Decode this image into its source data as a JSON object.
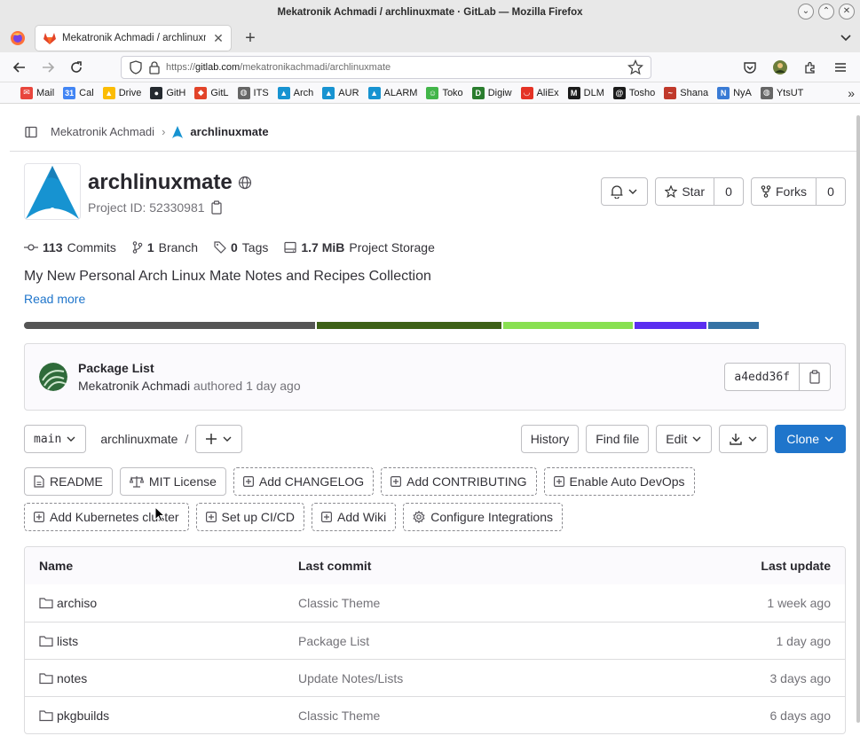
{
  "window": {
    "title": "Mekatronik Achmadi / archlinuxmate · GitLab — Mozilla Firefox"
  },
  "tab": {
    "title": "Mekatronik Achmadi / archlinuxmate"
  },
  "urlbar": {
    "prefix": "https://",
    "host": "gitlab.com",
    "path": "/mekatronikachmadi/archlinuxmate"
  },
  "bookmarks": [
    {
      "label": "Mail",
      "icon": "mail-icon",
      "color": "#e8453c",
      "glyph": "✉"
    },
    {
      "label": "Cal",
      "icon": "calendar-icon",
      "color": "#4285f4",
      "glyph": "31"
    },
    {
      "label": "Drive",
      "icon": "drive-icon",
      "color": "#fbbc04",
      "glyph": "▲"
    },
    {
      "label": "GitH",
      "icon": "github-icon",
      "color": "#24292f",
      "glyph": "●"
    },
    {
      "label": "GitL",
      "icon": "gitlab-icon",
      "color": "#e24329",
      "glyph": "◆"
    },
    {
      "label": "ITS",
      "icon": "globe-icon",
      "color": "#666666",
      "glyph": "◍"
    },
    {
      "label": "Arch",
      "icon": "arch-icon",
      "color": "#1793d1",
      "glyph": "▲"
    },
    {
      "label": "AUR",
      "icon": "arch-icon",
      "color": "#1793d1",
      "glyph": "▲"
    },
    {
      "label": "ALARM",
      "icon": "arch-icon",
      "color": "#1793d1",
      "glyph": "▲"
    },
    {
      "label": "Toko",
      "icon": "shop-icon",
      "color": "#42b549",
      "glyph": "☺"
    },
    {
      "label": "Digiw",
      "icon": "digiware-icon",
      "color": "#2a7d2e",
      "glyph": "D"
    },
    {
      "label": "AliEx",
      "icon": "aliexpress-icon",
      "color": "#e43225",
      "glyph": "◡"
    },
    {
      "label": "DLM",
      "icon": "dlm-icon",
      "color": "#1b1b1b",
      "glyph": "M"
    },
    {
      "label": "Tosho",
      "icon": "tosho-icon",
      "color": "#1b1b1b",
      "glyph": "@"
    },
    {
      "label": "Shana",
      "icon": "shana-icon",
      "color": "#c0392b",
      "glyph": "~"
    },
    {
      "label": "NyA",
      "icon": "nyaa-icon",
      "color": "#3a7bd5",
      "glyph": "N"
    },
    {
      "label": "YtsUT",
      "icon": "globe-icon",
      "color": "#666666",
      "glyph": "◍"
    }
  ],
  "breadcrumb": {
    "parent": "Mekatronik Achmadi",
    "current": "archlinuxmate"
  },
  "project": {
    "name": "archlinuxmate",
    "id_label": "Project ID: 52330981",
    "star_label": "Star",
    "star_count": "0",
    "forks_label": "Forks",
    "forks_count": "0",
    "description": "My New Personal Arch Linux Mate Notes and Recipes Collection",
    "read_more": "Read more"
  },
  "stats": {
    "commits_num": "113",
    "commits_label": "Commits",
    "branch_num": "1",
    "branch_label": "Branch",
    "tags_num": "0",
    "tags_label": "Tags",
    "storage_num": "1.7 MiB",
    "storage_label": "Project Storage"
  },
  "languages": [
    {
      "color": "#555555",
      "share": 0.397
    },
    {
      "color": "#3d6117",
      "share": 0.253
    },
    {
      "color": "#89e051",
      "share": 0.177
    },
    {
      "color": "#5a2ef0",
      "share": 0.098
    },
    {
      "color": "#3572a5",
      "share": 0.069
    }
  ],
  "last_commit": {
    "title": "Package List",
    "author": "Mekatronik Achmadi",
    "authored": "authored",
    "when": "1 day ago",
    "sha": "a4edd36f"
  },
  "repo_nav": {
    "branch": "main",
    "path": "archlinuxmate",
    "slash": "/",
    "history": "History",
    "find_file": "Find file",
    "edit": "Edit",
    "clone": "Clone"
  },
  "shortcuts": [
    {
      "label": "README",
      "icon": "file-icon",
      "dashed": false
    },
    {
      "label": "MIT License",
      "icon": "scale-icon",
      "dashed": false
    },
    {
      "label": "Add CHANGELOG",
      "icon": "plus-square-icon",
      "dashed": true
    },
    {
      "label": "Add CONTRIBUTING",
      "icon": "plus-square-icon",
      "dashed": true
    },
    {
      "label": "Enable Auto DevOps",
      "icon": "plus-square-icon",
      "dashed": true
    },
    {
      "label": "Add Kubernetes cluster",
      "icon": "plus-square-icon",
      "dashed": true
    },
    {
      "label": "Set up CI/CD",
      "icon": "plus-square-icon",
      "dashed": true
    },
    {
      "label": "Add Wiki",
      "icon": "plus-square-icon",
      "dashed": true
    },
    {
      "label": "Configure Integrations",
      "icon": "gear-icon",
      "dashed": true
    }
  ],
  "file_table": {
    "headers": {
      "name": "Name",
      "last_commit": "Last commit",
      "last_update": "Last update"
    },
    "rows": [
      {
        "name": "archiso",
        "commit": "Classic Theme",
        "updated": "1 week ago"
      },
      {
        "name": "lists",
        "commit": "Package List",
        "updated": "1 day ago"
      },
      {
        "name": "notes",
        "commit": "Update Notes/Lists",
        "updated": "3 days ago"
      },
      {
        "name": "pkgbuilds",
        "commit": "Classic Theme",
        "updated": "6 days ago"
      }
    ]
  }
}
